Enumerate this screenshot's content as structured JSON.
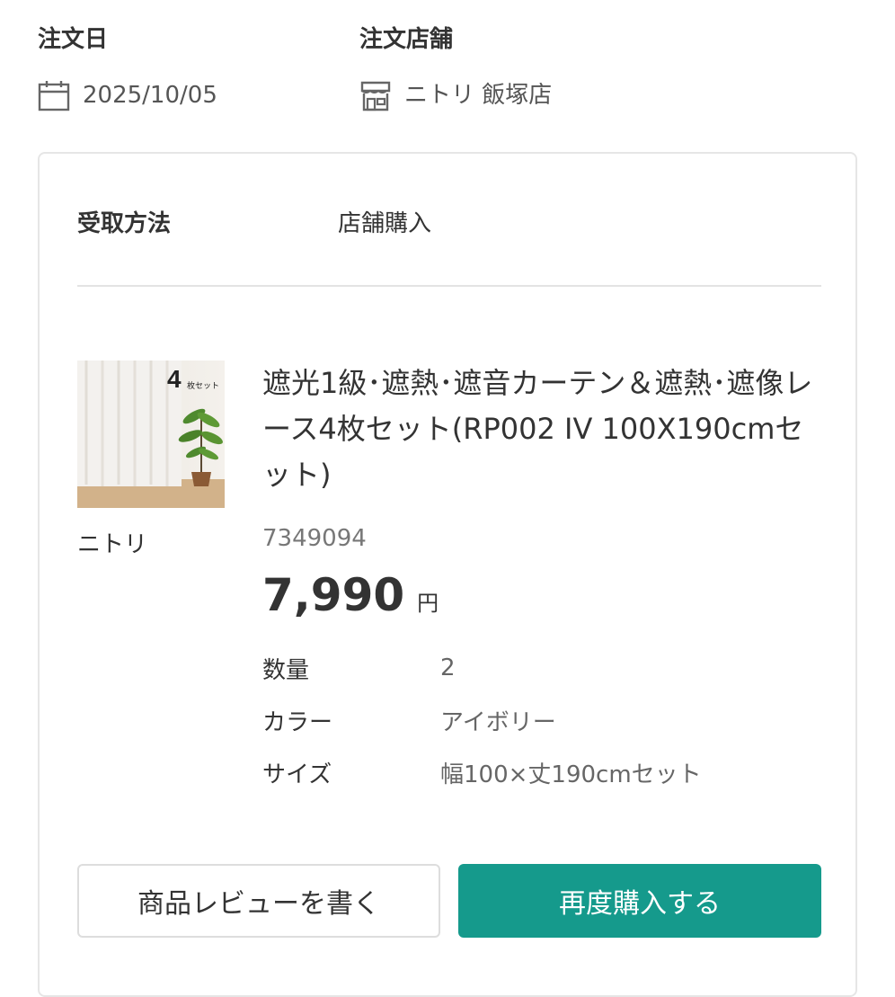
{
  "order": {
    "date_label": "注文日",
    "date_value": "2025/10/05",
    "store_label": "注文店舗",
    "store_value": "ニトリ 飯塚店",
    "date_icon": "calendar-icon",
    "store_icon": "store-icon"
  },
  "card": {
    "receive_label": "受取方法",
    "receive_value": "店舗購入",
    "product": {
      "brand": "ニトリ",
      "thumb_badge_number": "4",
      "thumb_badge_text": "枚セット",
      "title": "遮光1級･遮熱･遮音カーテン＆遮熱･遮像レース4枚セット(RP002 IV 100X190cmセット)",
      "code": "7349094",
      "price": "7,990",
      "price_unit": "円",
      "attributes": [
        {
          "key": "数量",
          "value": "2"
        },
        {
          "key": "カラー",
          "value": "アイボリー"
        },
        {
          "key": "サイズ",
          "value": "幅100×丈190cmセット"
        }
      ]
    },
    "buttons": {
      "review": "商品レビューを書く",
      "rebuy": "再度購入する"
    }
  },
  "colors": {
    "accent": "#159a8c",
    "text": "#333333",
    "muted": "#777777",
    "border": "#e6e6e6"
  }
}
